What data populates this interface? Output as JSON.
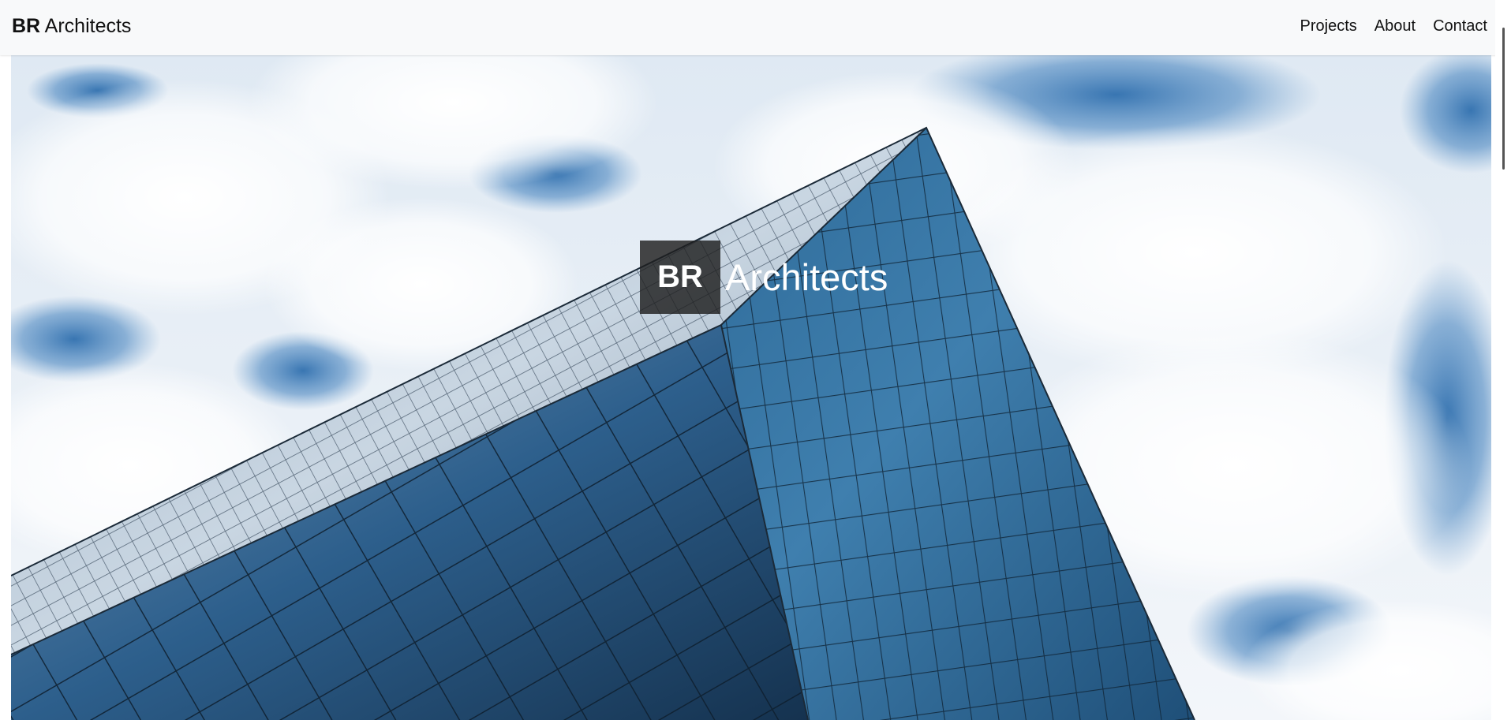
{
  "navbar": {
    "brand_bold": "BR",
    "brand_rest": " Architects",
    "links": [
      "Projects",
      "About",
      "Contact"
    ]
  },
  "hero": {
    "badge_text": "BR",
    "title_text": "Architects",
    "image_subject": "glass-skyscraper-against-cloudy-sky"
  },
  "colors": {
    "navbar_bg": "#f8f9fa",
    "sky_blue": "#3a78b4",
    "glass_blue": "#2f6d9a",
    "badge_bg": "#1e1e1e"
  }
}
